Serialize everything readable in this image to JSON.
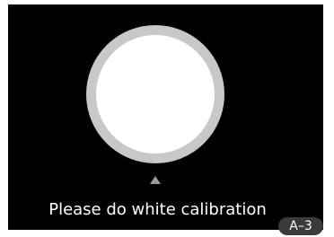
{
  "screen": {
    "message": "Please do white calibration",
    "target_icon": "white-calibration-target-icon",
    "pointer_icon": "up-pointer-icon"
  },
  "figure_label": "A–3",
  "colors": {
    "background": "#000000",
    "ring": "#c8c8c8",
    "disc": "#ffffff",
    "pointer": "#9a9a9a",
    "label_badge": "#3a3a3a"
  }
}
